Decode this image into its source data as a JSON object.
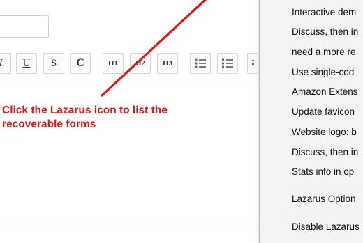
{
  "editor": {
    "toolbar": {
      "buttons": [
        {
          "name": "italic",
          "label": "I"
        },
        {
          "name": "underline",
          "label": "U"
        },
        {
          "name": "strikethrough",
          "label": "S"
        },
        {
          "name": "code",
          "label": "C"
        },
        {
          "name": "heading-1",
          "label": "H1"
        },
        {
          "name": "heading-2",
          "label": "H2"
        },
        {
          "name": "heading-3",
          "label": "H3"
        },
        {
          "name": "bulleted-list",
          "icon": "bulleted-list-icon"
        },
        {
          "name": "numbered-list",
          "icon": "numbered-list-icon"
        }
      ]
    }
  },
  "annotation": {
    "text": "Click the Lazarus icon to list the recoverable forms",
    "color": "#e01515"
  },
  "context_menu": {
    "items": [
      "Interactive dem",
      "Discuss, then in",
      "need a more re",
      "Use single-cod",
      "Amazon Extens",
      "Update favicon",
      "Website logo: b",
      "Discuss, then in",
      "Stats info in op"
    ],
    "options_label": "Lazarus Option",
    "disable_label": "Disable Lazarus"
  }
}
